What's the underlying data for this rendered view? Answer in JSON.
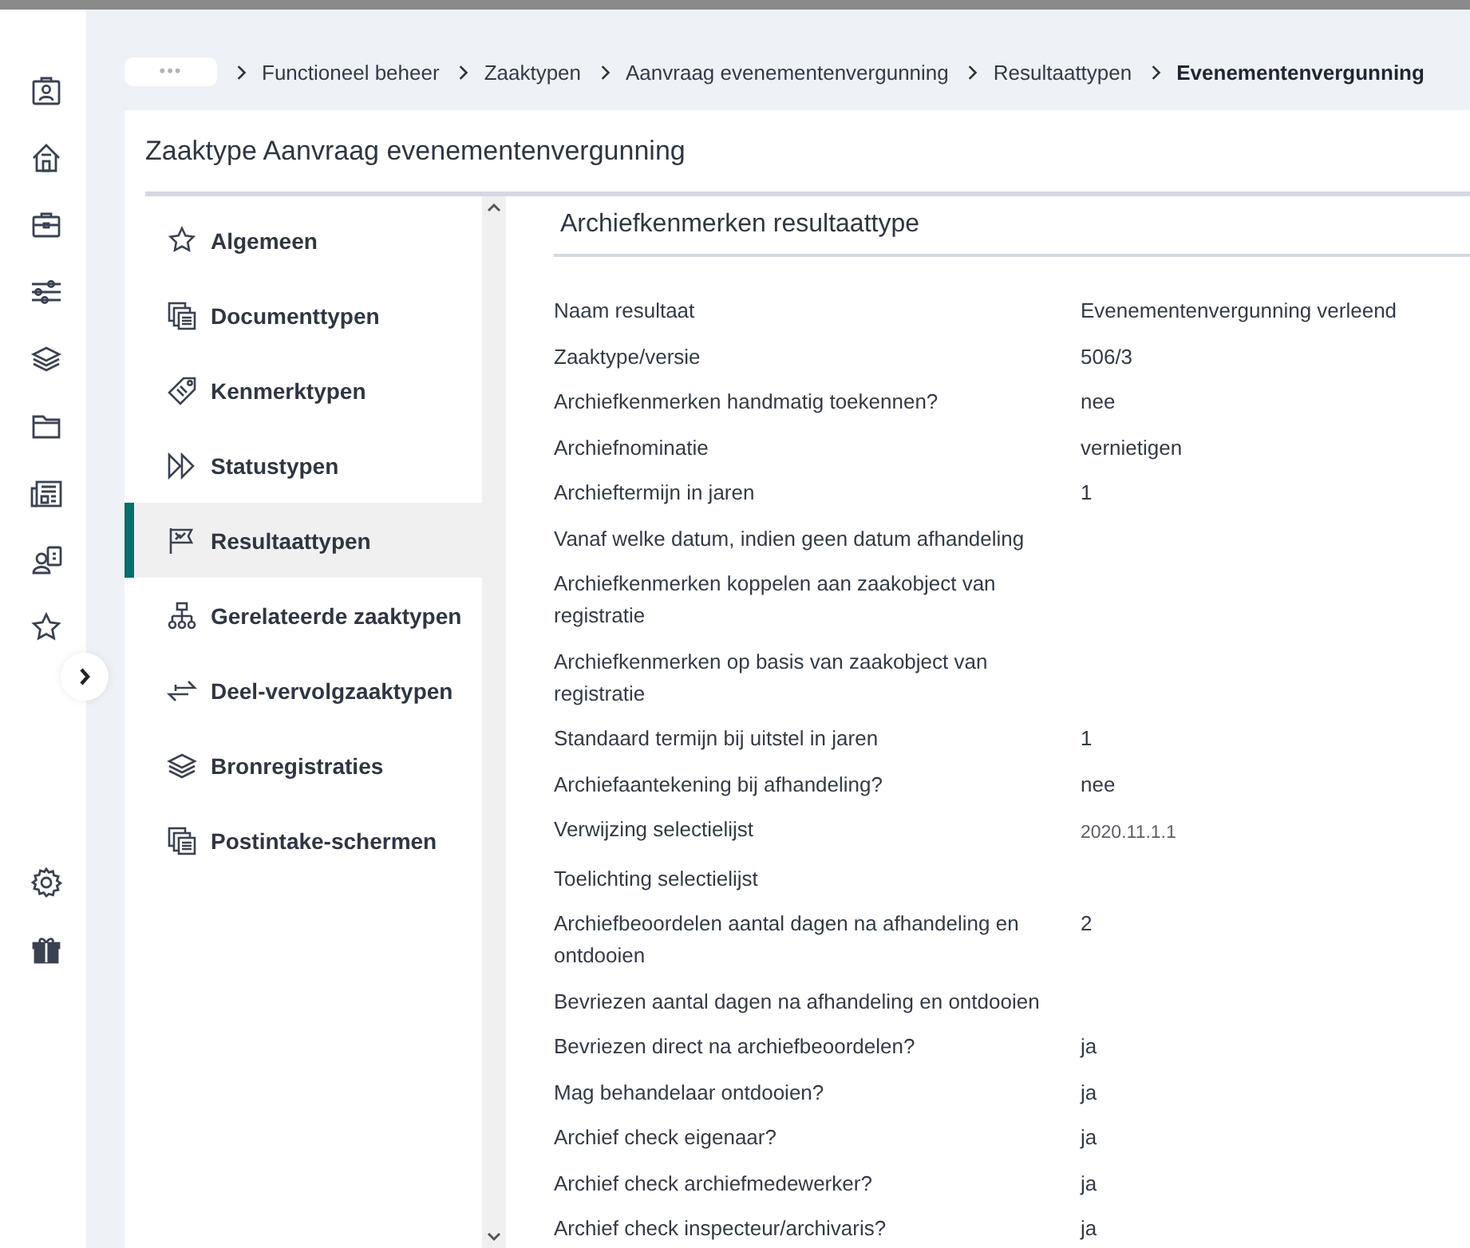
{
  "breadcrumb": {
    "collapsed": "•••",
    "items": [
      {
        "label": "Functioneel beheer",
        "current": false
      },
      {
        "label": "Zaaktypen",
        "current": false
      },
      {
        "label": "Aanvraag evenementenvergunning",
        "current": false
      },
      {
        "label": "Resultaattypen",
        "current": false
      },
      {
        "label": "Evenementenvergunning",
        "current": true
      }
    ]
  },
  "title": "Zaaktype Aanvraag evenementenvergunning",
  "menu": [
    {
      "label": "Algemeen",
      "selected": false
    },
    {
      "label": "Documenttypen",
      "selected": false
    },
    {
      "label": "Kenmerktypen",
      "selected": false
    },
    {
      "label": "Statustypen",
      "selected": false
    },
    {
      "label": "Resultaattypen",
      "selected": true
    },
    {
      "label": "Gerelateerde zaaktypen",
      "selected": false
    },
    {
      "label": "Deel-vervolgzaaktypen",
      "selected": false
    },
    {
      "label": "Bronregistraties",
      "selected": false
    },
    {
      "label": "Postintake-schermen",
      "selected": false
    }
  ],
  "section_title": "Archiefkenmerken resultaattype",
  "fields": [
    {
      "label": "Naam resultaat",
      "value": "Evenementenvergunning verleend"
    },
    {
      "label": "Zaaktype/versie",
      "value": "506/3"
    },
    {
      "label": "Archiefkenmerken handmatig toekennen?",
      "value": "nee"
    },
    {
      "label": "Archiefnominatie",
      "value": "vernietigen"
    },
    {
      "label": "Archieftermijn in jaren",
      "value": "1"
    },
    {
      "label": "Vanaf welke datum, indien geen datum afhandeling"
    },
    {
      "label": "Archiefkenmerken koppelen aan zaakobject van registratie"
    },
    {
      "label": "Archiefkenmerken op basis van zaakobject van registratie"
    },
    {
      "label": "Standaard termijn bij uitstel in jaren",
      "value": "1"
    },
    {
      "label": "Archiefaantekening bij afhandeling?",
      "value": "nee"
    },
    {
      "label": "Verwijzing selectielijst",
      "value": "2020.11.1.1",
      "kind": "reference"
    },
    {
      "label": "Toelichting selectielijst"
    },
    {
      "label": "Archiefbeoordelen aantal dagen na afhandeling en ontdooien",
      "value": "2"
    },
    {
      "label": "Bevriezen aantal dagen na afhandeling en ontdooien"
    },
    {
      "label": "Bevriezen direct na archiefbeoordelen?",
      "value": "ja"
    },
    {
      "label": "Mag behandelaar ontdooien?",
      "value": "ja"
    },
    {
      "label": "Archief check eigenaar?",
      "value": "ja"
    },
    {
      "label": "Archief check archiefmedewerker?",
      "value": "ja"
    },
    {
      "label": "Archief check inspecteur/archivaris?",
      "value": "ja"
    }
  ]
}
